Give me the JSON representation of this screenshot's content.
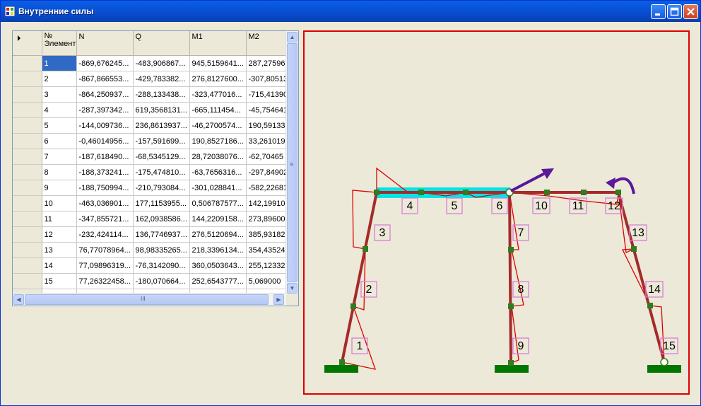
{
  "window": {
    "title": "Внутренние силы"
  },
  "table": {
    "columns": [
      "№ Элемент",
      "N",
      "Q",
      "M1",
      "M2"
    ],
    "rows": [
      [
        "1",
        "-869,676245...",
        "-483,906867...",
        "945,5159641...",
        "287,27596"
      ],
      [
        "2",
        "-867,866553...",
        "-429,783382...",
        "276,8127600...",
        "-307,80513"
      ],
      [
        "3",
        "-864,250937...",
        "-288,133438...",
        "-323,477016...",
        "-715,41390"
      ],
      [
        "4",
        "-287,397342...",
        "619,3568131...",
        "-665,111454...",
        "-45,754641"
      ],
      [
        "5",
        "-144,009736...",
        "236,8613937...",
        "-46,2700574...",
        "190,59133"
      ],
      [
        "6",
        "-0,46014956...",
        "-157,591699...",
        "190,8527186...",
        "33,261019"
      ],
      [
        "7",
        "-187,618490...",
        "-68,5345129...",
        "28,72038076...",
        "-62,70465"
      ],
      [
        "8",
        "-188,373241...",
        "-175,474810...",
        "-63,7656316...",
        "-297,84902"
      ],
      [
        "9",
        "-188,750994...",
        "-210,793084...",
        "-301,028841...",
        "-582,22681"
      ],
      [
        "10",
        "-463,036901...",
        "177,1153955...",
        "0,506787577...",
        "142,19910"
      ],
      [
        "11",
        "-347,855721...",
        "162,0938586...",
        "144,2209158...",
        "273,89600"
      ],
      [
        "12",
        "-232,424114...",
        "136,7746937...",
        "276,5120694...",
        "385,93182"
      ],
      [
        "13",
        "76,77078964...",
        "98,98335265...",
        "218,3396134...",
        "354,43524"
      ],
      [
        "14",
        "77,09896319...",
        "-76,3142090...",
        "360,0503643...",
        "255,12332"
      ],
      [
        "15",
        "77,26322458...",
        "-180,070664...",
        "252,6543777...",
        "5,069000"
      ]
    ],
    "selected_row": 0,
    "scroll_thumb_glyph": "≡",
    "hscroll_thumb_glyph": "III"
  },
  "diagram": {
    "element_labels": [
      "1",
      "2",
      "3",
      "4",
      "5",
      "6",
      "7",
      "8",
      "9",
      "10",
      "11",
      "12",
      "13",
      "14",
      "15"
    ],
    "colors": {
      "frame": "#A52A2A",
      "diagram": "#E00000",
      "node": "#2E7D1E",
      "support": "#007700",
      "label_box": "#D87FD8",
      "highlight": "#00E5E5",
      "load": "#5A189A"
    }
  }
}
